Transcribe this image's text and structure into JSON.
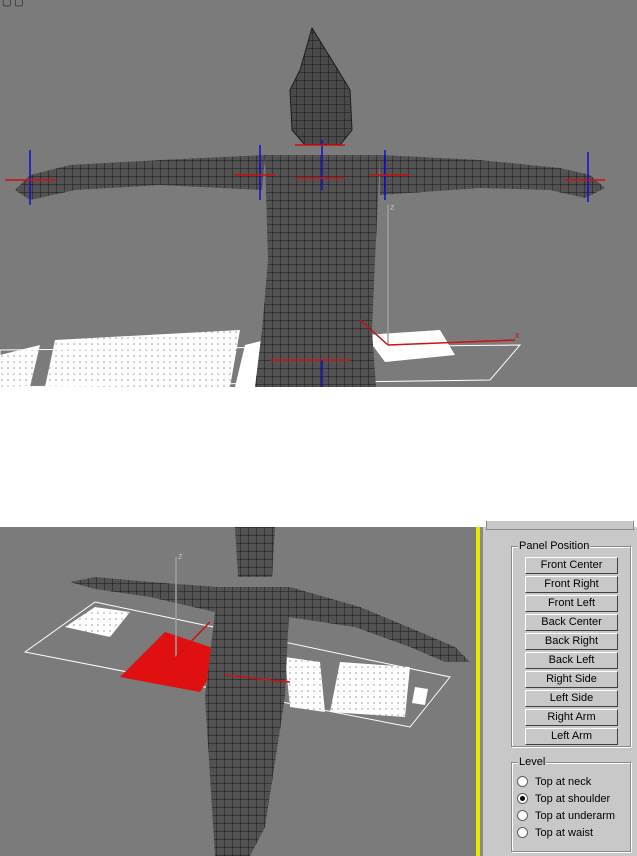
{
  "panel_position": {
    "title": "Panel Position",
    "buttons": [
      "Front Center",
      "Front Right",
      "Front Left",
      "Back Center",
      "Back Right",
      "Back Left",
      "Right Side",
      "Left Side",
      "Right Arm",
      "Left Arm"
    ]
  },
  "level": {
    "title": "Level",
    "options": [
      {
        "label": "Top at neck",
        "selected": false
      },
      {
        "label": "Top at shoulder",
        "selected": true
      },
      {
        "label": "Top at underarm",
        "selected": false
      },
      {
        "label": "Top at waist",
        "selected": false
      }
    ]
  },
  "viewport_labels": {
    "axis_x": "x",
    "axis_z": "z"
  },
  "colors": {
    "viewport_bg": "#7b7b7b",
    "panel_bg": "#c8c8c8",
    "active_border": "#e8e800",
    "selected_panel": "#e01010"
  }
}
